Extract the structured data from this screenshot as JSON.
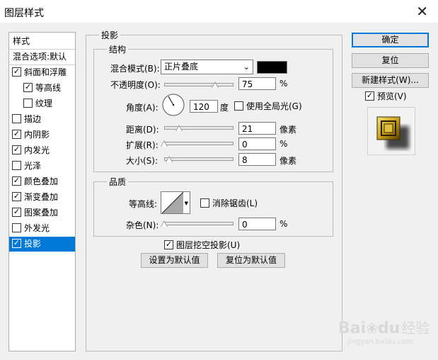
{
  "window": {
    "title": "图层样式",
    "close_glyph": "✕"
  },
  "sidebar": {
    "items": [
      {
        "label": "样式",
        "checkbox": false
      },
      {
        "label": "混合选项:默认",
        "checkbox": false
      },
      {
        "label": "斜面和浮雕",
        "checkbox": true,
        "checked": true
      },
      {
        "label": "等高线",
        "checkbox": true,
        "checked": true,
        "indent": true
      },
      {
        "label": "纹理",
        "checkbox": true,
        "checked": false,
        "indent": true
      },
      {
        "label": "描边",
        "checkbox": true,
        "checked": false
      },
      {
        "label": "内阴影",
        "checkbox": true,
        "checked": true
      },
      {
        "label": "内发光",
        "checkbox": true,
        "checked": true
      },
      {
        "label": "光泽",
        "checkbox": true,
        "checked": false
      },
      {
        "label": "颜色叠加",
        "checkbox": true,
        "checked": true
      },
      {
        "label": "渐变叠加",
        "checkbox": true,
        "checked": true
      },
      {
        "label": "图案叠加",
        "checkbox": true,
        "checked": true
      },
      {
        "label": "外发光",
        "checkbox": true,
        "checked": false
      },
      {
        "label": "投影",
        "checkbox": true,
        "checked": true,
        "selected": true
      }
    ]
  },
  "main": {
    "section_title": "投影",
    "structure": {
      "title": "结构",
      "blend_mode_label": "混合模式(B):",
      "blend_mode_value": "正片叠底",
      "blend_color": "#000000",
      "opacity_label": "不透明度(O):",
      "opacity_value": "75",
      "opacity_unit": "%",
      "angle_label": "角度(A):",
      "angle_value": "120",
      "angle_unit": "度",
      "global_light_label": "使用全局光(G)",
      "global_light_checked": false,
      "distance_label": "距离(D):",
      "distance_value": "21",
      "distance_unit": "像素",
      "spread_label": "扩展(R):",
      "spread_value": "0",
      "spread_unit": "%",
      "size_label": "大小(S):",
      "size_value": "8",
      "size_unit": "像素"
    },
    "quality": {
      "title": "品质",
      "contour_label": "等高线:",
      "antialias_label": "消除锯齿(L)",
      "antialias_checked": false,
      "noise_label": "杂色(N):",
      "noise_value": "0",
      "noise_unit": "%"
    },
    "knockout_label": "图层挖空投影(U)",
    "knockout_checked": true,
    "set_default_label": "设置为默认值",
    "reset_default_label": "复位为默认值"
  },
  "buttons": {
    "ok": "确定",
    "reset": "复位",
    "new_style": "新建样式(W)...",
    "preview_label": "预览(V)",
    "preview_checked": true
  },
  "watermark": {
    "brand": "Bai",
    "paw": "du",
    "suffix": "经验",
    "url": "jingyan.baidu.com"
  }
}
